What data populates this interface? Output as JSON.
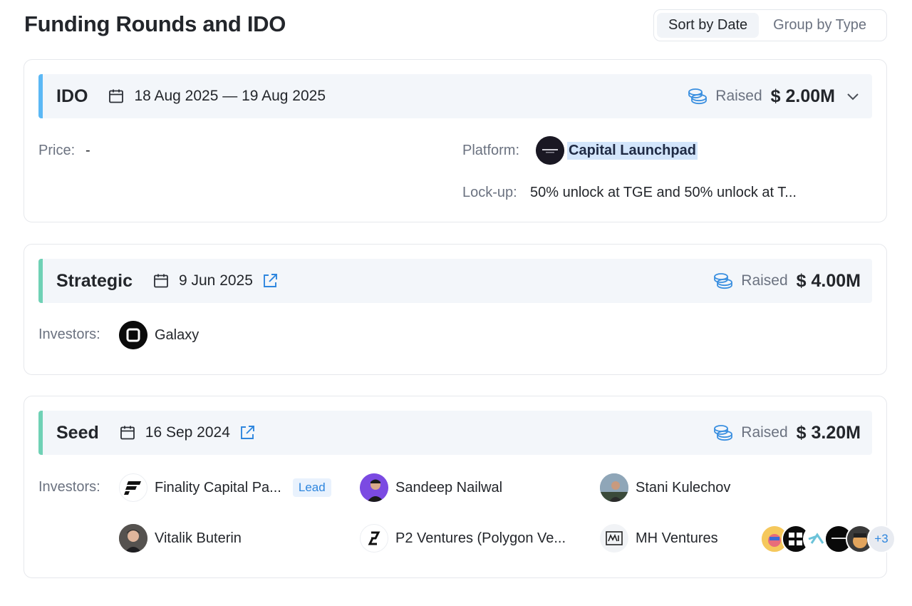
{
  "header": {
    "title": "Funding Rounds and IDO",
    "sort_tabs": [
      "Sort by Date",
      "Group by Type"
    ]
  },
  "colors": {
    "ido_accent": "#5bb8f5",
    "strategic_accent": "#6fd1b5",
    "seed_accent": "#6fd1b5",
    "link_blue": "#2e86de"
  },
  "ido": {
    "name": "IDO",
    "date": "18 Aug 2025 — 19 Aug 2025",
    "raised_label": "Raised",
    "raised_amount": "$ 2.00M",
    "price_label": "Price:",
    "price_value": "-",
    "platform_label": "Platform:",
    "platform_name": "Capital Launchpad",
    "lockup_label": "Lock-up:",
    "lockup_value": "50% unlock at TGE and 50% unlock at T..."
  },
  "strategic": {
    "name": "Strategic",
    "date": "9 Jun 2025",
    "raised_label": "Raised",
    "raised_amount": "$ 4.00M",
    "investors_label": "Investors:",
    "investors": [
      "Galaxy"
    ]
  },
  "seed": {
    "name": "Seed",
    "date": "16 Sep 2024",
    "raised_label": "Raised",
    "raised_amount": "$ 3.20M",
    "investors_label": "Investors:",
    "investors": [
      "Finality Capital Pa...",
      "Sandeep Nailwal",
      "Stani Kulechov",
      "Vitalik Buterin",
      "P2 Ventures (Polygon Ve...",
      "MH Ventures"
    ],
    "lead_badge": "Lead",
    "more_count": "+3"
  },
  "icons": [
    "calendar-icon",
    "external-link-icon",
    "coins-icon",
    "chevron-down-icon"
  ]
}
